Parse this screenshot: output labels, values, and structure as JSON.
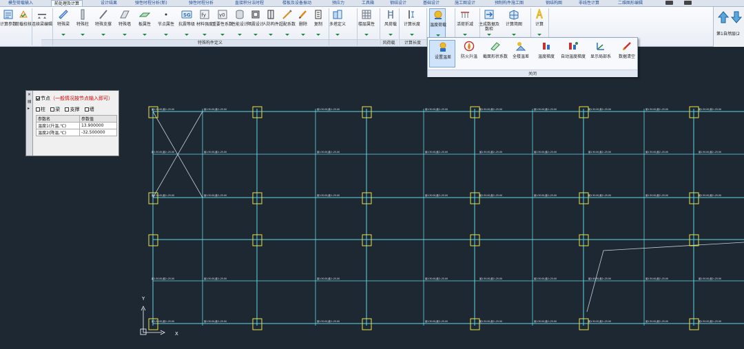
{
  "tabs": [
    {
      "label": "模型荷载输入",
      "active": false
    },
    {
      "label": "前处理及计算",
      "active": true
    },
    {
      "label": "设计结果",
      "active": false
    },
    {
      "label": "弹性时程分析(新)",
      "active": false
    },
    {
      "label": "弹性时程分析",
      "active": false
    },
    {
      "label": "直接积分法时程",
      "active": false
    },
    {
      "label": "楼板及设备振动",
      "active": false
    },
    {
      "label": "预应力",
      "active": false
    },
    {
      "label": "工具箱",
      "active": false
    },
    {
      "label": "钢结设计",
      "active": false
    },
    {
      "label": "基础设计",
      "active": false
    },
    {
      "label": "施工图设计",
      "active": false
    },
    {
      "label": "预制构件施工图",
      "active": false
    },
    {
      "label": "钢结构图",
      "active": false
    },
    {
      "label": "非线性计算",
      "active": false
    },
    {
      "label": "二维图形编辑",
      "active": false
    }
  ],
  "ribbon": {
    "buttons": [
      {
        "label": "计算参数",
        "icon": "calc-params-icon"
      },
      {
        "label": "荷载校核",
        "icon": "load-check-icon"
      },
      {
        "label": "连续梁编辑",
        "icon": "continuous-beam-icon"
      },
      {
        "label": "特殊梁",
        "icon": "special-beam-icon"
      },
      {
        "label": "特殊柱",
        "icon": "special-column-icon"
      },
      {
        "label": "特殊支撑",
        "icon": "special-brace-icon"
      },
      {
        "label": "特殊墙",
        "icon": "special-wall-icon"
      },
      {
        "label": "板属性",
        "icon": "slab-property-icon"
      },
      {
        "label": "节点属性",
        "icon": "node-property-icon"
      },
      {
        "label": "抗震等级",
        "icon": "seismic-grade-icon"
      },
      {
        "label": "材料强度",
        "icon": "material-strength-icon"
      },
      {
        "label": "重要性系数",
        "icon": "importance-factor-icon"
      },
      {
        "label": "性能设计",
        "icon": "performance-design-icon"
      },
      {
        "label": "隔震设计",
        "icon": "isolation-design-icon"
      },
      {
        "label": "人防构件",
        "icon": "civil-defense-icon"
      },
      {
        "label": "超配系数",
        "icon": "over-factor-icon"
      },
      {
        "label": "删除",
        "icon": "delete-icon"
      },
      {
        "label": "复制",
        "icon": "copy-icon"
      },
      {
        "label": "多塔定义",
        "icon": "multi-tower-icon"
      },
      {
        "label": "楼层属性",
        "icon": "floor-property-icon"
      },
      {
        "label": "风荷载",
        "icon": "wind-load-icon"
      },
      {
        "label": "计算长度",
        "icon": "calc-length-icon"
      },
      {
        "label": "温度荷载",
        "icon": "temperature-load-icon"
      },
      {
        "label": "活荷折减",
        "icon": "live-load-reduction-icon"
      },
      {
        "label": "生成数据及数检",
        "icon": "generate-data-icon"
      },
      {
        "label": "计算简图",
        "icon": "calc-diagram-icon"
      },
      {
        "label": "计算",
        "icon": "compute-icon"
      }
    ],
    "groups": [
      {
        "label": "特殊构件定义"
      },
      {
        "label": "风荷载"
      },
      {
        "label": "计算长度"
      }
    ],
    "floor_label": "第1自然层(2"
  },
  "temperature_menu": {
    "items": [
      {
        "label": "设置温差",
        "icon": "set-temperature-icon",
        "selected": true
      },
      {
        "label": "防火升温",
        "icon": "fire-temperature-icon",
        "selected": false
      },
      {
        "label": "截面形状系数",
        "icon": "section-shape-icon",
        "selected": false
      },
      {
        "label": "全楼温差",
        "icon": "whole-building-icon",
        "selected": false
      },
      {
        "label": "温度梯度",
        "icon": "temperature-gradient-icon",
        "selected": false
      },
      {
        "label": "自动温度梯度",
        "icon": "auto-gradient-icon",
        "selected": false
      },
      {
        "label": "显示局部系",
        "icon": "local-axis-icon",
        "selected": false
      },
      {
        "label": "数据清空",
        "icon": "clear-data-icon",
        "selected": false
      }
    ],
    "close_label": "关闭"
  },
  "node_panel": {
    "title": "节点",
    "hint": "（一般情况按节点输入即可）",
    "types": [
      "柱",
      "梁",
      "支撑",
      "墙"
    ],
    "table_headers": [
      "参数名",
      "参数值"
    ],
    "rows": [
      {
        "name": "温度1(升温,℃)",
        "value": "13.900000"
      },
      {
        "name": "温度2(降温,℃)",
        "value": "-32.500000"
      }
    ]
  },
  "canvas": {
    "node_label": "最1:30.00,最2:-25.00",
    "axis_y": "Y",
    "axis_x": "X"
  }
}
